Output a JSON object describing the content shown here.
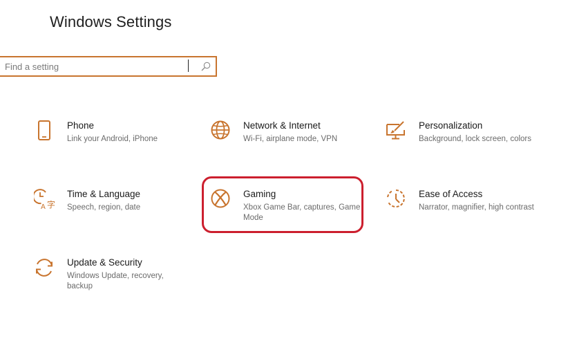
{
  "window": {
    "title": "Windows Settings"
  },
  "search": {
    "placeholder": "Find a setting",
    "value": ""
  },
  "accent_color": "#c8742e",
  "highlight_color": "#cc1f2e",
  "tiles": [
    {
      "title": "Phone",
      "description": "Link your Android, iPhone",
      "icon": "phone-icon"
    },
    {
      "title": "Network & Internet",
      "description": "Wi-Fi, airplane mode, VPN",
      "icon": "globe-icon"
    },
    {
      "title": "Personalization",
      "description": "Background, lock screen, colors",
      "icon": "personalization-icon"
    },
    {
      "title": "Time & Language",
      "description": "Speech, region, date",
      "icon": "time-language-icon"
    },
    {
      "title": "Gaming",
      "description": "Xbox Game Bar, captures, Game Mode",
      "icon": "xbox-icon",
      "highlighted": true
    },
    {
      "title": "Ease of Access",
      "description": "Narrator, magnifier, high contrast",
      "icon": "ease-of-access-icon"
    },
    {
      "title": "Update & Security",
      "description": "Windows Update, recovery, backup",
      "icon": "update-icon"
    }
  ]
}
